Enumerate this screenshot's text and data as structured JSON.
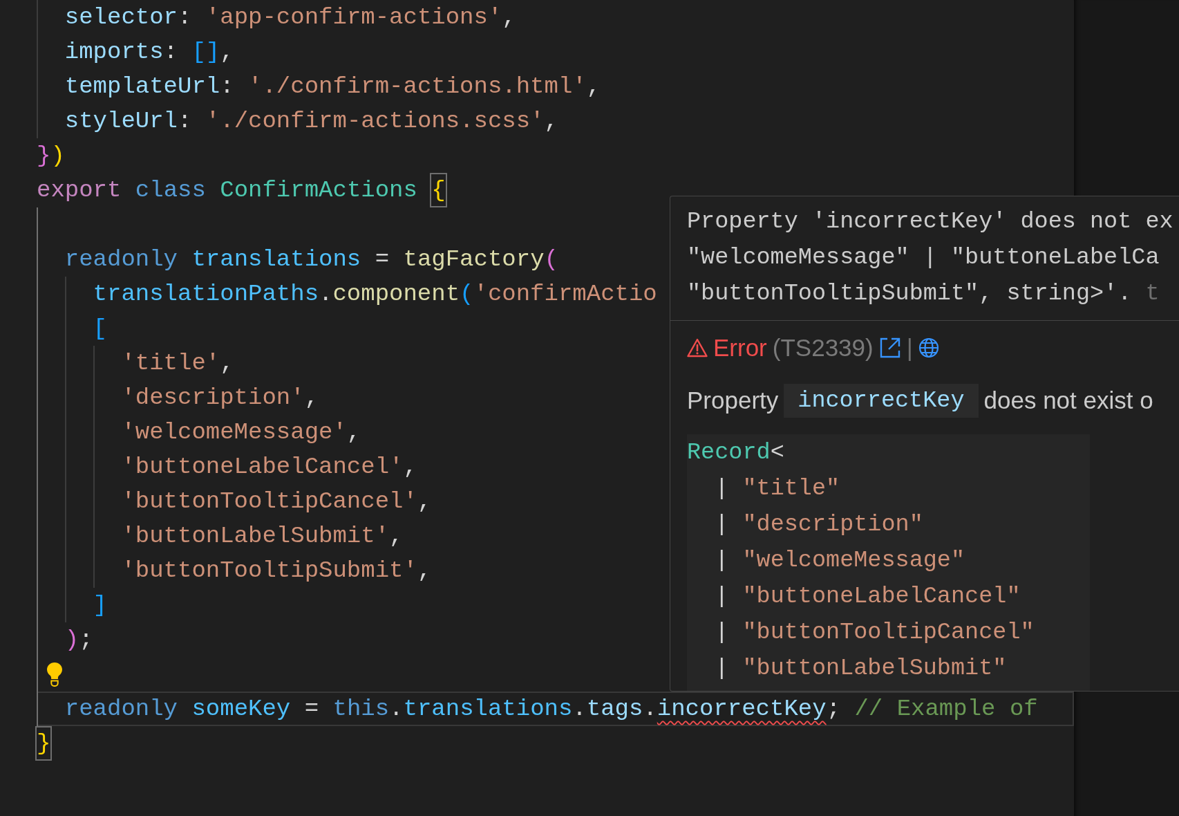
{
  "editor": {
    "lines": [
      {
        "children": [
          {
            "current": false,
            "lightbulb": false,
            "tokens": [
              {
                "text": "selector",
                "kind": "property"
              },
              {
                "text": ": ",
                "kind": "punct"
              },
              {
                "text": "'app-confirm-actions'",
                "kind": "string"
              },
              {
                "text": ",",
                "kind": "punct"
              }
            ]
          },
          {
            "current": false,
            "lightbulb": false,
            "tokens": [
              {
                "text": "imports",
                "kind": "property"
              },
              {
                "text": ": ",
                "kind": "punct"
              },
              {
                "text": "[]",
                "kind": "bracket3"
              },
              {
                "text": ",",
                "kind": "punct"
              }
            ]
          },
          {
            "current": false,
            "lightbulb": false,
            "tokens": [
              {
                "text": "templateUrl",
                "kind": "property"
              },
              {
                "text": ": ",
                "kind": "punct"
              },
              {
                "text": "'./confirm-actions.html'",
                "kind": "string"
              },
              {
                "text": ",",
                "kind": "punct"
              }
            ]
          },
          {
            "current": false,
            "lightbulb": false,
            "tokens": [
              {
                "text": "styleUrl",
                "kind": "property"
              },
              {
                "text": ": ",
                "kind": "punct"
              },
              {
                "text": "'./confirm-actions.scss'",
                "kind": "string"
              },
              {
                "text": ",",
                "kind": "punct"
              }
            ]
          }
        ]
      },
      {
        "current": false,
        "lightbulb": false,
        "tokens": [
          {
            "text": "}",
            "kind": "bracket2"
          },
          {
            "text": ")",
            "kind": "bracket1"
          }
        ]
      },
      {
        "current": false,
        "lightbulb": false,
        "tokens": [
          {
            "text": "export ",
            "kind": "control"
          },
          {
            "text": "class ",
            "kind": "keyword"
          },
          {
            "text": "ConfirmActions ",
            "kind": "type"
          },
          {
            "text": "{",
            "kind": "bracket1",
            "matched": true
          }
        ],
        "children": [
          {
            "current": false,
            "lightbulb": false
          },
          {
            "current": false,
            "lightbulb": false,
            "tokens": [
              {
                "text": "readonly ",
                "kind": "keyword"
              },
              {
                "text": "translations",
                "kind": "variable"
              },
              {
                "text": " = ",
                "kind": "punct"
              },
              {
                "text": "tagFactory",
                "kind": "function"
              },
              {
                "text": "(",
                "kind": "bracket2"
              }
            ],
            "children": [
              {
                "current": false,
                "lightbulb": false,
                "tokens": [
                  {
                    "text": "translationPaths",
                    "kind": "variable"
                  },
                  {
                    "text": ".",
                    "kind": "punct"
                  },
                  {
                    "text": "component",
                    "kind": "function"
                  },
                  {
                    "text": "(",
                    "kind": "bracket3"
                  },
                  {
                    "text": "'confirmActio",
                    "kind": "string"
                  }
                ]
              },
              {
                "current": false,
                "lightbulb": false,
                "tokens": [
                  {
                    "text": "[",
                    "kind": "bracket3"
                  }
                ],
                "children": [
                  {
                    "current": false,
                    "lightbulb": false,
                    "tokens": [
                      {
                        "text": "'title'",
                        "kind": "string"
                      },
                      {
                        "text": ",",
                        "kind": "punct"
                      }
                    ]
                  },
                  {
                    "current": false,
                    "lightbulb": false,
                    "tokens": [
                      {
                        "text": "'description'",
                        "kind": "string"
                      },
                      {
                        "text": ",",
                        "kind": "punct"
                      }
                    ]
                  },
                  {
                    "current": false,
                    "lightbulb": false,
                    "tokens": [
                      {
                        "text": "'welcomeMessage'",
                        "kind": "string"
                      },
                      {
                        "text": ",",
                        "kind": "punct"
                      }
                    ]
                  },
                  {
                    "current": false,
                    "lightbulb": false,
                    "tokens": [
                      {
                        "text": "'buttoneLabelCancel'",
                        "kind": "string"
                      },
                      {
                        "text": ",",
                        "kind": "punct"
                      }
                    ]
                  },
                  {
                    "current": false,
                    "lightbulb": false,
                    "tokens": [
                      {
                        "text": "'buttonTooltipCancel'",
                        "kind": "string"
                      },
                      {
                        "text": ",",
                        "kind": "punct"
                      }
                    ]
                  },
                  {
                    "current": false,
                    "lightbulb": false,
                    "tokens": [
                      {
                        "text": "'buttonLabelSubmit'",
                        "kind": "string"
                      },
                      {
                        "text": ",",
                        "kind": "punct"
                      }
                    ]
                  },
                  {
                    "current": false,
                    "lightbulb": false,
                    "tokens": [
                      {
                        "text": "'buttonTooltipSubmit'",
                        "kind": "string"
                      },
                      {
                        "text": ",",
                        "kind": "punct"
                      }
                    ]
                  }
                ]
              },
              {
                "current": false,
                "lightbulb": false,
                "tokens": [
                  {
                    "text": "]",
                    "kind": "bracket3"
                  }
                ]
              }
            ]
          },
          {
            "current": false,
            "lightbulb": false,
            "tokens": [
              {
                "text": ")",
                "kind": "bracket2"
              },
              {
                "text": ";",
                "kind": "punct"
              }
            ]
          },
          {
            "current": false,
            "lightbulb": true
          },
          {
            "current": true,
            "lightbulb": false,
            "tokens": [
              {
                "text": "readonly ",
                "kind": "keyword"
              },
              {
                "text": "someKey",
                "kind": "variable"
              },
              {
                "text": " = ",
                "kind": "punct"
              },
              {
                "text": "this",
                "kind": "keyword"
              },
              {
                "text": ".",
                "kind": "punct"
              },
              {
                "text": "translations",
                "kind": "variable"
              },
              {
                "text": ".",
                "kind": "punct"
              },
              {
                "text": "tags",
                "kind": "property"
              },
              {
                "text": ".",
                "kind": "punct"
              },
              {
                "text": "incorrectKey",
                "kind": "property",
                "error": true
              },
              {
                "text": "; ",
                "kind": "punct"
              },
              {
                "text": "// Example of",
                "kind": "comment"
              }
            ]
          }
        ]
      },
      {
        "current": false,
        "lightbulb": false,
        "tokens": [
          {
            "text": "}",
            "kind": "bracket1",
            "matched": true
          }
        ]
      }
    ]
  },
  "hover": {
    "message_lines": [
      "Property 'incorrectKey' does not ex",
      "\"welcomeMessage\" | \"buttoneLabelCa",
      "\"buttonTooltipSubmit\", string>'."
    ],
    "source": "t",
    "severity": {
      "kind": "error",
      "label": "Error"
    },
    "code": "(TS2339)",
    "separator": "|",
    "description": {
      "before": "Property",
      "code": "incorrectKey",
      "after": "does not exist o"
    },
    "type_lines": [
      {
        "tokens": [
          {
            "text": "Record",
            "kind": "type"
          },
          {
            "text": "<",
            "kind": "punct"
          }
        ],
        "children": [
          {
            "tokens": [
              {
                "text": "| ",
                "kind": "punct"
              },
              {
                "text": "\"title\"",
                "kind": "string"
              }
            ]
          },
          {
            "tokens": [
              {
                "text": "| ",
                "kind": "punct"
              },
              {
                "text": "\"description\"",
                "kind": "string"
              }
            ]
          },
          {
            "tokens": [
              {
                "text": "| ",
                "kind": "punct"
              },
              {
                "text": "\"welcomeMessage\"",
                "kind": "string"
              }
            ]
          },
          {
            "tokens": [
              {
                "text": "| ",
                "kind": "punct"
              },
              {
                "text": "\"buttoneLabelCancel\"",
                "kind": "string"
              }
            ]
          },
          {
            "tokens": [
              {
                "text": "| ",
                "kind": "punct"
              },
              {
                "text": "\"buttonTooltipCancel\"",
                "kind": "string"
              }
            ]
          },
          {
            "tokens": [
              {
                "text": "| ",
                "kind": "punct"
              },
              {
                "text": "\"buttonLabelSubmit\"",
                "kind": "string"
              }
            ]
          }
        ]
      }
    ]
  }
}
